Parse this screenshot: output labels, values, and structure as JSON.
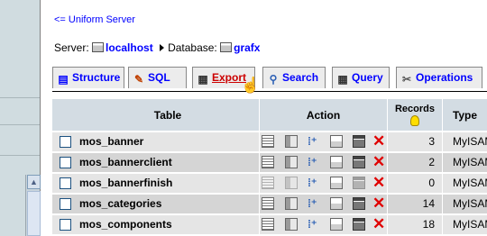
{
  "back_link": "<= Uniform Server",
  "breadcrumb": {
    "server_label": "Server:",
    "server_name": "localhost",
    "database_label": "Database:",
    "database_name": "grafx"
  },
  "tabs": [
    {
      "label": "Structure",
      "icon": "structure-icon"
    },
    {
      "label": "SQL",
      "icon": "sql-icon"
    },
    {
      "label": "Export",
      "icon": "export-icon",
      "active": true
    },
    {
      "label": "Search",
      "icon": "search-icon"
    },
    {
      "label": "Query",
      "icon": "query-icon"
    },
    {
      "label": "Operations",
      "icon": "operations-icon"
    }
  ],
  "table_headers": {
    "table": "Table",
    "action": "Action",
    "records": "Records",
    "type": "Type"
  },
  "rows": [
    {
      "name": "mos_banner",
      "records": "3",
      "type": "MyISAM"
    },
    {
      "name": "mos_bannerclient",
      "records": "2",
      "type": "MyISAM"
    },
    {
      "name": "mos_bannerfinish",
      "records": "0",
      "type": "MyISAM"
    },
    {
      "name": "mos_categories",
      "records": "14",
      "type": "MyISAM"
    },
    {
      "name": "mos_components",
      "records": "18",
      "type": "MyISAM"
    }
  ],
  "colors": {
    "header_bg": "#d3dce3",
    "row_light": "#e5e5e5",
    "row_dark": "#d5d5d5",
    "link": "#0000ff",
    "active_tab": "#cc0000"
  }
}
